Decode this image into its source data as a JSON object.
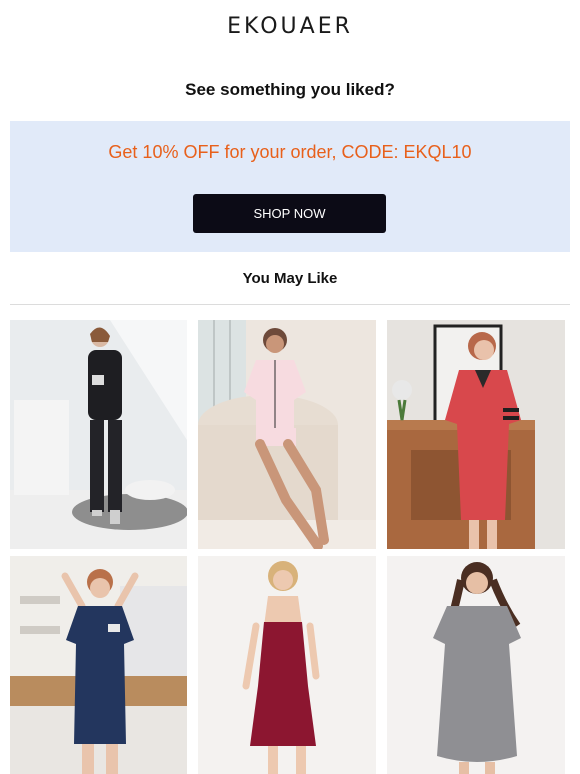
{
  "brand": {
    "logo_text": "EKOUAER"
  },
  "headline": "See something you liked?",
  "promo": {
    "text": "Get 10% OFF for your order, CODE: EKQL10",
    "button_label": "SHOP NOW",
    "background": "#e1eaf9",
    "text_color": "#e8601b"
  },
  "recommendations": {
    "title": "You May Like"
  }
}
